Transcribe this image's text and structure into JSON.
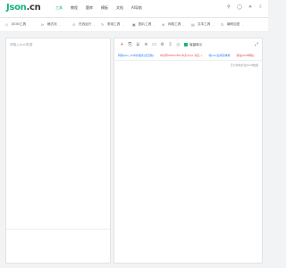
{
  "logo": {
    "text_main": "Json",
    "text_dot": ".",
    "text_cn": "cn"
  },
  "nav": [
    "工具",
    "教程",
    "题库",
    "模板",
    "文档",
    "AI导航"
  ],
  "top_icons": [
    "search-icon",
    "user-icon",
    "light-icon",
    "night-icon"
  ],
  "toolbar": [
    {
      "icon": "json-icon",
      "label": "JSON工具"
    },
    {
      "icon": "format-icon",
      "label": "格式化"
    },
    {
      "icon": "online-icon",
      "label": "在线运行"
    },
    {
      "icon": "code-icon",
      "label": "常用工具"
    },
    {
      "icon": "image-icon",
      "label": "图片工具"
    },
    {
      "icon": "web-icon",
      "label": "网络工具"
    },
    {
      "icon": "text-icon",
      "label": "文本工具"
    },
    {
      "icon": "encode-icon",
      "label": "编码加密"
    }
  ],
  "editor": {
    "placeholder": "请输入json数据"
  },
  "right": {
    "checkbox_label": "保留转义",
    "links": [
      {
        "text": "转换json_to中文格式(去空格)",
        "color": "blue"
      },
      {
        "text": "中文转UNICODE,中文(0)(0 对应..)",
        "color": "red"
      },
      {
        "text": "将json生成实体类",
        "color": "blue"
      },
      {
        "text": "我在JSON网站",
        "color": "red"
      }
    ],
    "hint": "已为你格式化JSON数据"
  },
  "colors": {
    "brand": "#15b37a",
    "link_blue": "#1677ff",
    "link_red": "#e5484d"
  }
}
